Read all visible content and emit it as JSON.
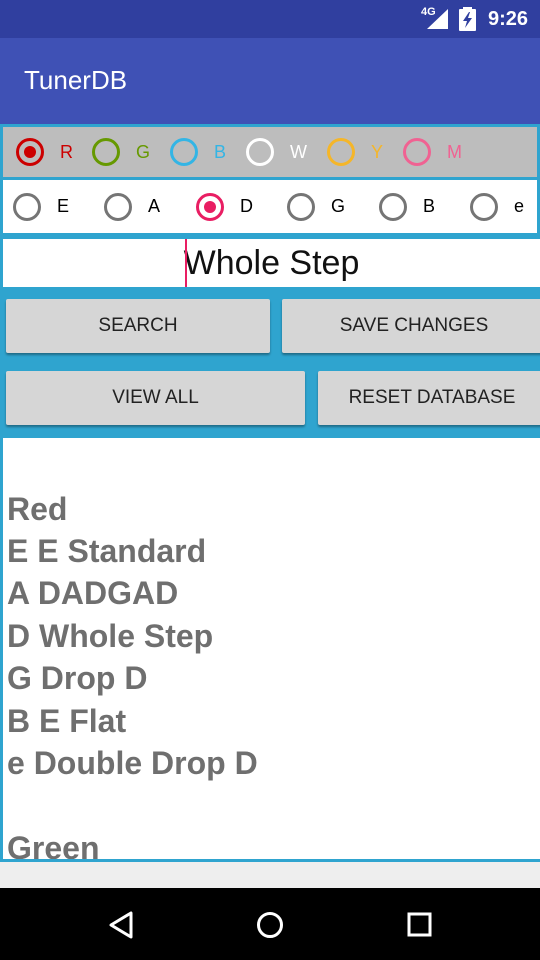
{
  "status_bar": {
    "network": "4G",
    "time": "9:26",
    "icons": [
      "signal-icon",
      "battery-charging-icon"
    ]
  },
  "app": {
    "title": "TunerDB"
  },
  "color_options": [
    {
      "label": "R",
      "color": "#CC0000",
      "selected": true
    },
    {
      "label": "G",
      "color": "#669900",
      "selected": false
    },
    {
      "label": "B",
      "color": "#33B5E5",
      "selected": false
    },
    {
      "label": "W",
      "color": "#FFFFFF",
      "selected": false
    },
    {
      "label": "Y",
      "color": "#F5B629",
      "selected": false
    },
    {
      "label": "M",
      "color": "#F06292",
      "selected": false
    }
  ],
  "string_options": [
    {
      "label": "E",
      "selected": false
    },
    {
      "label": "A",
      "selected": false
    },
    {
      "label": "D",
      "selected": true
    },
    {
      "label": "G",
      "selected": false
    },
    {
      "label": "B",
      "selected": false
    },
    {
      "label": "e",
      "selected": false
    }
  ],
  "tuning_input": {
    "value": "Whole Step"
  },
  "buttons": {
    "search": "SEARCH",
    "save": "SAVE CHANGES",
    "view_all": "VIEW ALL",
    "reset": "RESET DATABASE"
  },
  "results": [
    "Red",
    "E E Standard",
    "A DADGAD",
    "D Whole Step",
    "G Drop D",
    "B E Flat",
    "e Double Drop D",
    "",
    "Green"
  ],
  "colors": {
    "accent": "#E91E63",
    "primary": "#3F51B5",
    "primary_dark": "#303F9F",
    "border_blue": "#2FA4CF"
  },
  "nav_bar": [
    "back-icon",
    "home-icon",
    "recents-icon"
  ]
}
